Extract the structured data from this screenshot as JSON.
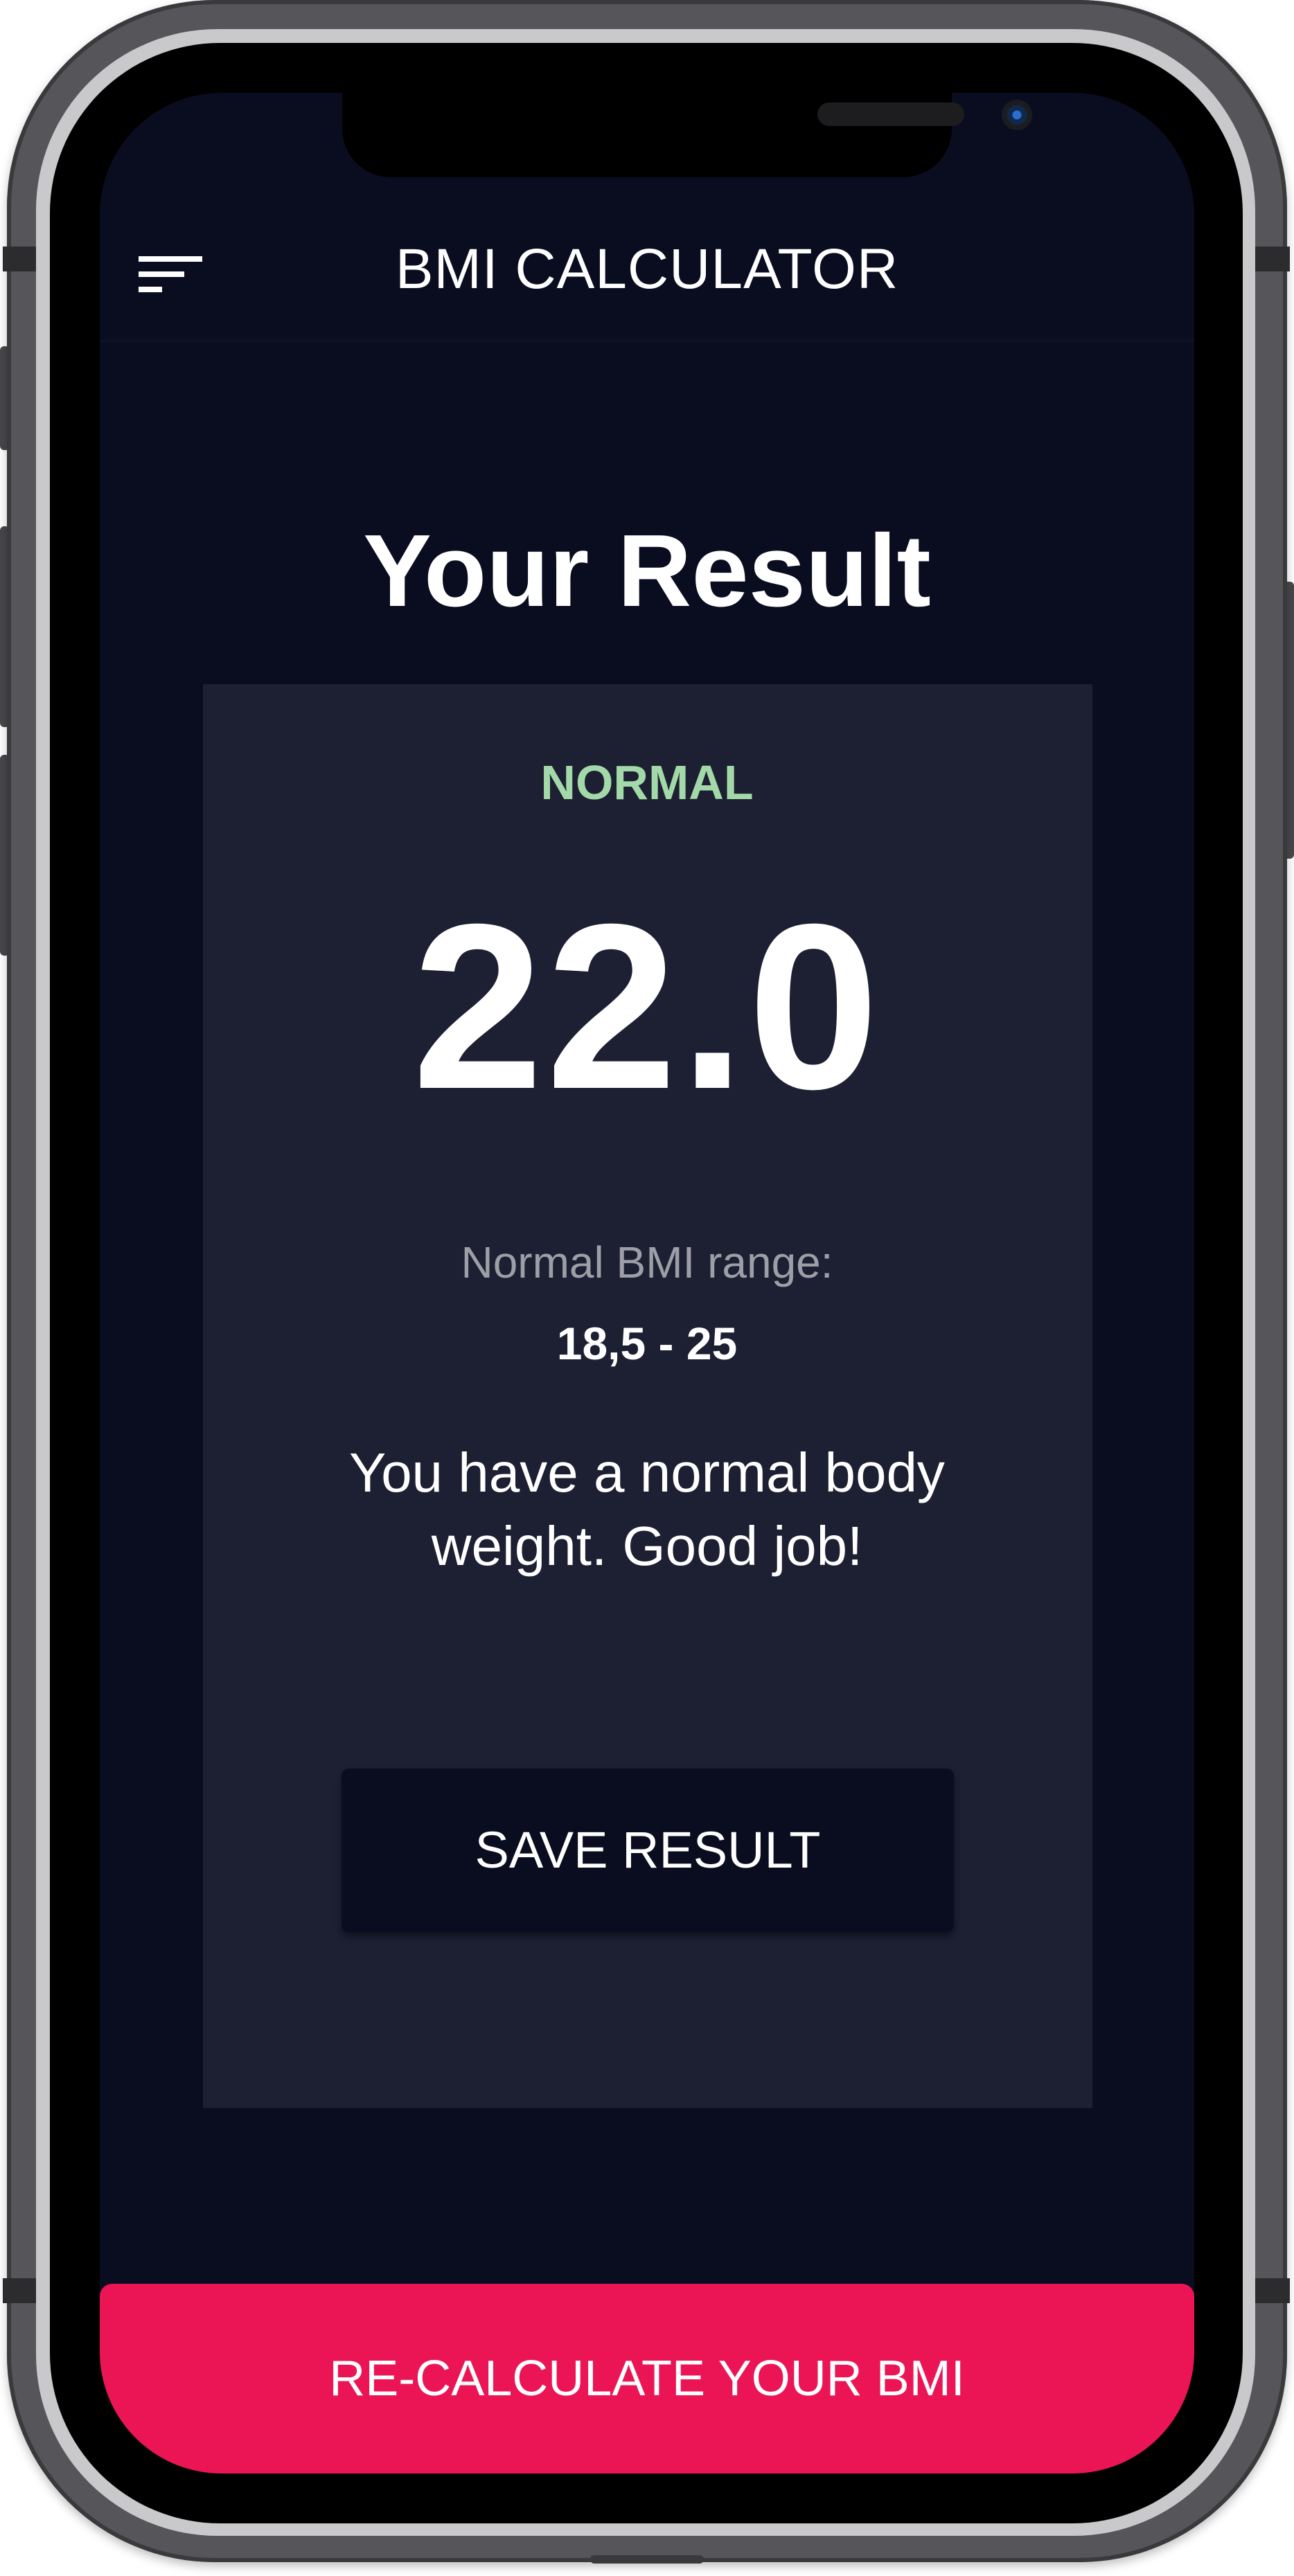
{
  "app_bar": {
    "title": "BMI CALCULATOR",
    "menu_icon": "sort-menu-icon"
  },
  "result": {
    "heading": "Your Result",
    "status": "NORMAL",
    "status_color": "#a3d9a8",
    "bmi": "22.0",
    "range_label": "Normal BMI range:",
    "range_value": "18,5 - 25",
    "message": "You have a normal body weight. Good job!",
    "save_label": "SAVE RESULT"
  },
  "footer": {
    "recalculate_label": "RE-CALCULATE YOUR BMI",
    "accent_color": "#eb1555"
  },
  "theme": {
    "background": "#0a0d20",
    "card": "#1d1f33"
  }
}
